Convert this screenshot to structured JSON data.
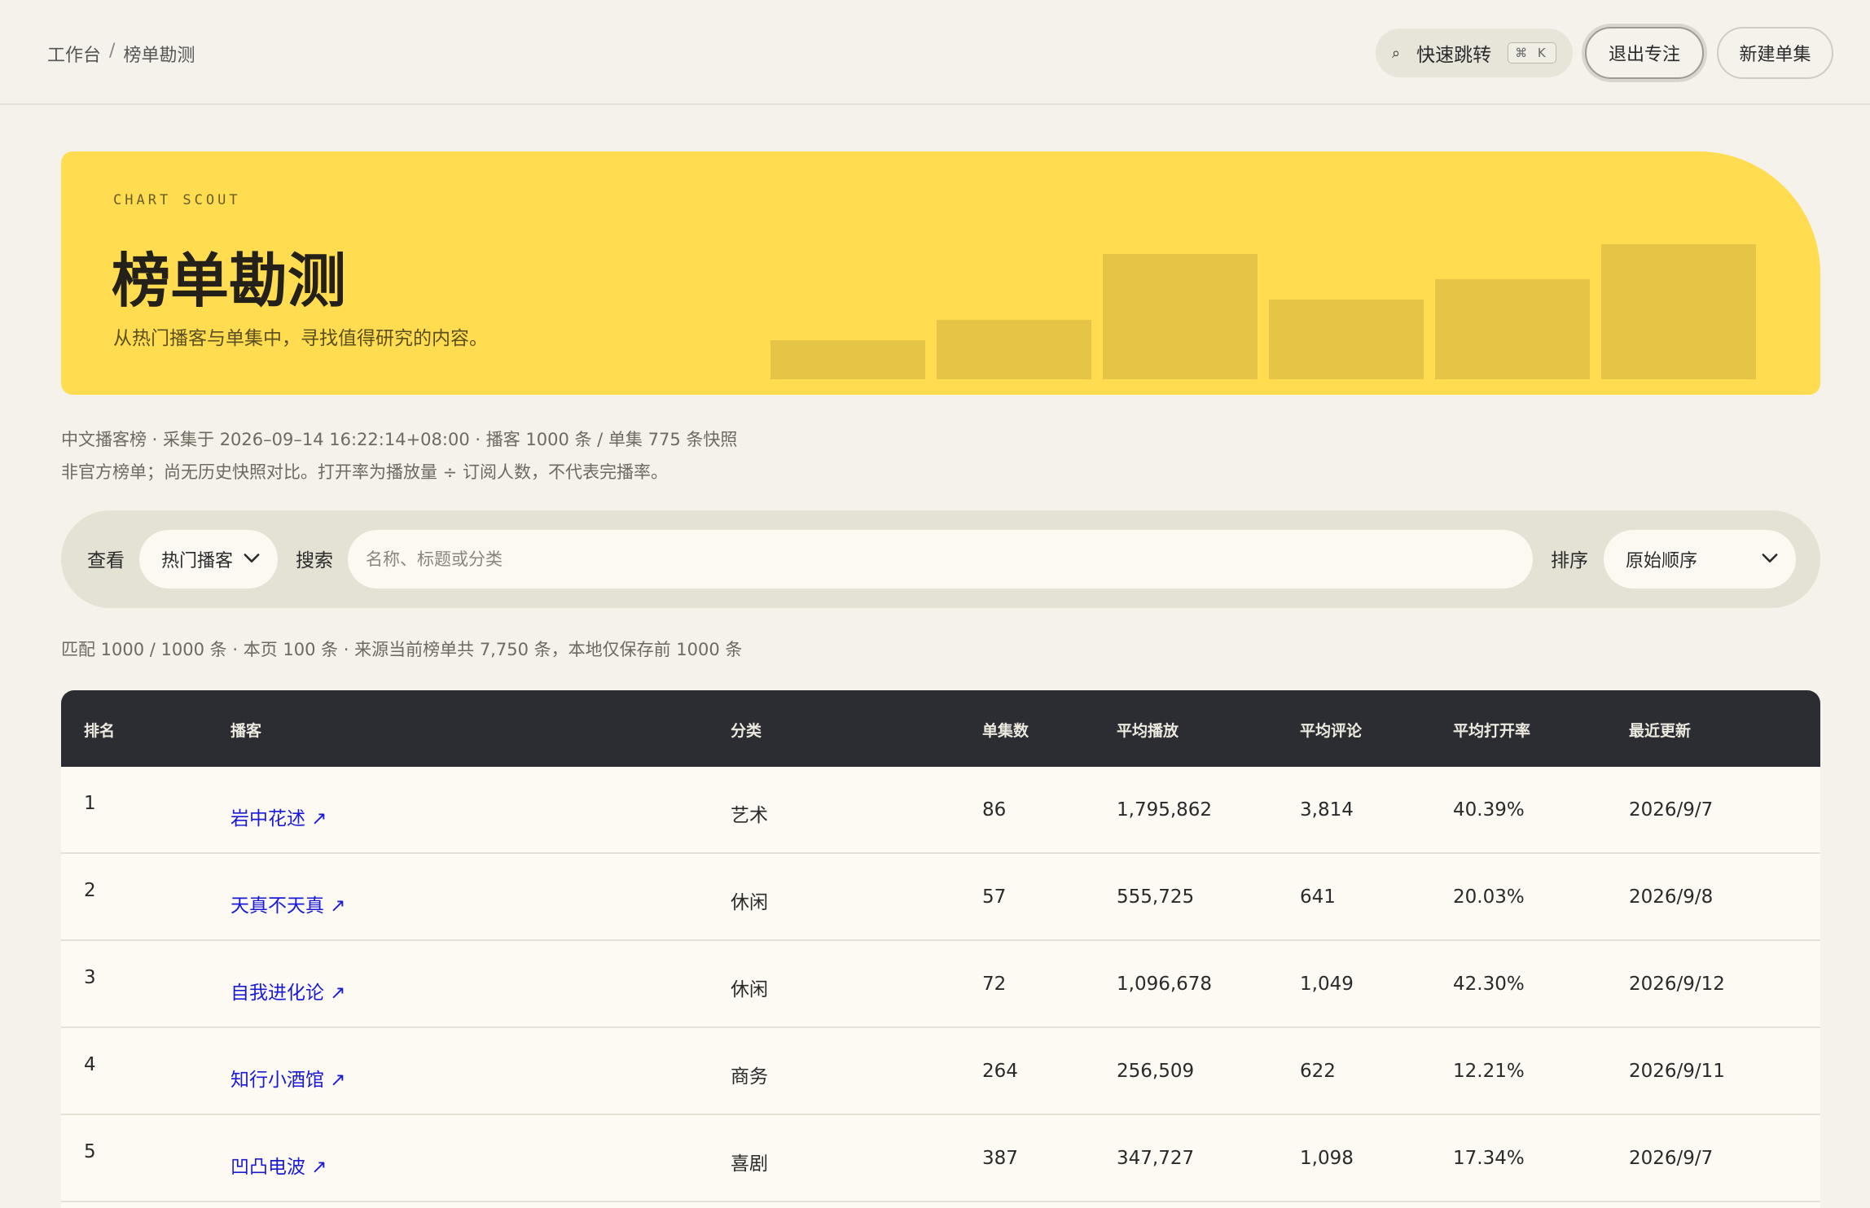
{
  "breadcrumb": {
    "root": "工作台",
    "separator": "/",
    "current": "榜单勘测"
  },
  "toolbar": {
    "quick_jump_label": "快速跳转",
    "quick_jump_shortcut": "⌘ K",
    "exit_focus_label": "退出专注",
    "new_episode_label": "新建单集"
  },
  "hero": {
    "eyebrow": "CHART SCOUT",
    "title": "榜单勘测",
    "subtitle": "从热门播客与单集中，寻找值得研究的内容。",
    "bg_color": "#ffdc50",
    "decor_bar_levels": [
      0.29,
      0.44,
      0.93,
      0.59,
      0.74,
      1.0
    ]
  },
  "meta": {
    "line1": "中文播客榜 · 采集于 2026–09–14 16:22:14+08:00 · 播客 1000 条 / 单集 775 条快照",
    "line2": "非官方榜单；尚无历史快照对比。打开率为播放量 ÷ 订阅人数，不代表完播率。"
  },
  "filters": {
    "view_label": "查看",
    "view_value": "热门播客",
    "search_label": "搜索",
    "search_placeholder": "名称、标题或分类",
    "search_value": "",
    "sort_label": "排序",
    "sort_value": "原始顺序"
  },
  "summary": "匹配 1000 / 1000 条 · 本页 100 条 · 来源当前榜单共 7,750 条，本地仅保存前 1000 条",
  "table": {
    "columns": [
      "排名",
      "播客",
      "分类",
      "单集数",
      "平均播放",
      "平均评论",
      "平均打开率",
      "最近更新"
    ],
    "rows": [
      {
        "rank": "1",
        "podcast": "岩中花述 ↗",
        "category": "艺术",
        "episodes": "86",
        "avg_plays": "1,795,862",
        "avg_comments": "3,814",
        "avg_open_rate": "40.39%",
        "updated": "2026/9/7"
      },
      {
        "rank": "2",
        "podcast": "天真不天真 ↗",
        "category": "休闲",
        "episodes": "57",
        "avg_plays": "555,725",
        "avg_comments": "641",
        "avg_open_rate": "20.03%",
        "updated": "2026/9/8"
      },
      {
        "rank": "3",
        "podcast": "自我进化论 ↗",
        "category": "休闲",
        "episodes": "72",
        "avg_plays": "1,096,678",
        "avg_comments": "1,049",
        "avg_open_rate": "42.30%",
        "updated": "2026/9/12"
      },
      {
        "rank": "4",
        "podcast": "知行小酒馆 ↗",
        "category": "商务",
        "episodes": "264",
        "avg_plays": "256,509",
        "avg_comments": "622",
        "avg_open_rate": "12.21%",
        "updated": "2026/9/11"
      },
      {
        "rank": "5",
        "podcast": "凹凸电波 ↗",
        "category": "喜剧",
        "episodes": "387",
        "avg_plays": "347,727",
        "avg_comments": "1,098",
        "avg_open_rate": "17.34%",
        "updated": "2026/9/7"
      }
    ]
  },
  "colors": {
    "page_bg": "#f4f2ea",
    "header_dark": "#2b2d33",
    "link": "#1a1ad6",
    "accent_yellow": "#ffdc50"
  }
}
